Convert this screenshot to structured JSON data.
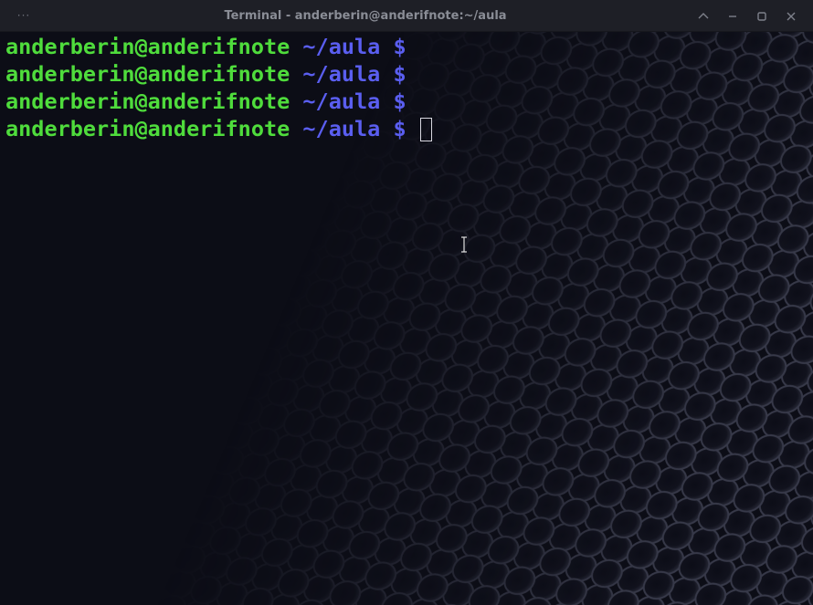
{
  "window": {
    "title": "Terminal - anderberin@anderifnote:~/aula",
    "menu_icon": "ellipsis-icon",
    "controls": [
      "chevron-up-icon",
      "minimize-icon",
      "maximize-icon",
      "close-icon"
    ]
  },
  "terminal": {
    "prompt": {
      "user_host": "anderberin@anderifnote",
      "path_symbol": " ~/aula $ "
    },
    "lines": [
      {
        "user_host": "anderberin@anderifnote",
        "rest": " ~/aula $"
      },
      {
        "user_host": "anderberin@anderifnote",
        "rest": " ~/aula $"
      },
      {
        "user_host": "anderberin@anderifnote",
        "rest": " ~/aula $"
      },
      {
        "user_host": "anderberin@anderifnote",
        "rest": " ~/aula $ "
      }
    ],
    "colors": {
      "user_host": "#4fdc3c",
      "path": "#5a5ef0",
      "background": "#0c0d16"
    }
  }
}
